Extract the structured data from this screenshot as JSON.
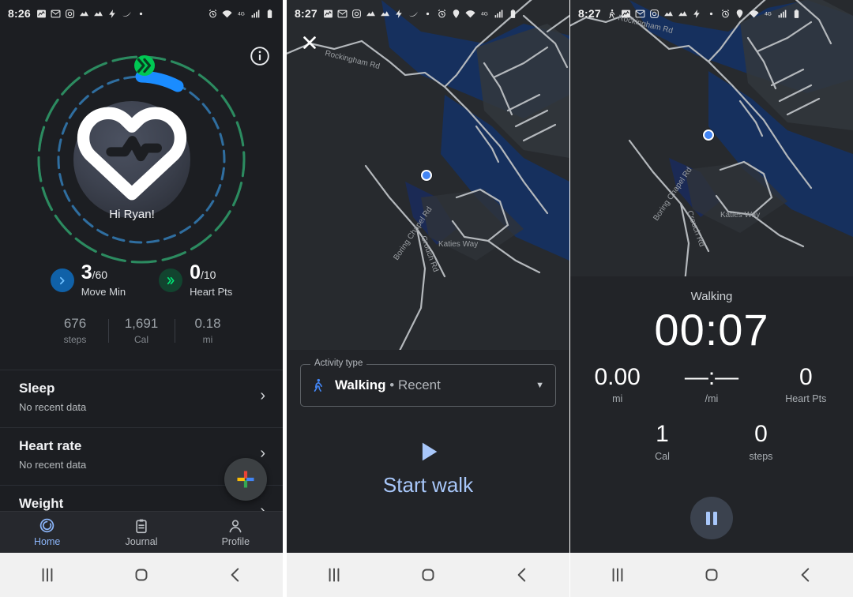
{
  "panels": {
    "home": {
      "statusbar": {
        "clock": "8:26",
        "icons": [
          "inv-icon",
          "gmail-icon",
          "instagram-icon",
          "chart-icon",
          "chart-icon",
          "bolt-icon",
          "swoosh-icon",
          "dot-icon",
          "alarm-icon",
          "wifi-icon",
          "4g-icon",
          "signal-icon",
          "battery-icon"
        ]
      },
      "info_icon": "info-icon",
      "greeting": "Hi Ryan!",
      "ring_badge_icon": "double-chevron-icon",
      "move_min": {
        "icon": "chevron-icon",
        "value": "3",
        "goal": "/60",
        "label": "Move Min"
      },
      "heart_pts": {
        "icon": "double-chevron-icon",
        "value": "0",
        "goal": "/10",
        "label": "Heart Pts"
      },
      "substats": [
        {
          "value": "676",
          "caption": "steps"
        },
        {
          "value": "1,691",
          "caption": "Cal"
        },
        {
          "value": "0.18",
          "caption": "mi"
        }
      ],
      "rows": [
        {
          "title": "Sleep",
          "subtitle": "No recent data"
        },
        {
          "title": "Heart rate",
          "subtitle": "No recent data"
        },
        {
          "title": "Weight",
          "subtitle": ""
        }
      ],
      "fab_icon": "google-plus-icon",
      "nav": [
        {
          "label": "Home",
          "icon": "home-ring-icon",
          "active": true
        },
        {
          "label": "Journal",
          "icon": "clipboard-icon",
          "active": false
        },
        {
          "label": "Profile",
          "icon": "person-icon",
          "active": false
        }
      ]
    },
    "start": {
      "statusbar": {
        "clock": "8:27",
        "icons": [
          "inv-icon",
          "gmail-icon",
          "instagram-icon",
          "chart-icon",
          "chart-icon",
          "bolt-icon",
          "swoosh-icon",
          "dot-icon",
          "alarm-icon",
          "pin-icon",
          "wifi-icon",
          "4g-icon",
          "signal-icon",
          "battery-icon"
        ]
      },
      "close_icon": "close-icon",
      "map_labels": [
        "Rockingham Rd",
        "Boring Chapel Rd",
        "Crouch Rd",
        "Katies Way"
      ],
      "activity_label": "Activity type",
      "activity_value": "Walking",
      "activity_suffix": "• Recent",
      "activity_icon": "walking-icon",
      "dropdown_icon": "chevron-down-icon",
      "start_icon": "play-icon",
      "start_label": "Start walk"
    },
    "tracking": {
      "statusbar": {
        "clock": "8:27",
        "icons": [
          "walking-icon",
          "inv-icon",
          "gmail-icon",
          "instagram-icon",
          "chart-icon",
          "chart-icon",
          "bolt-icon",
          "dot-icon",
          "alarm-icon",
          "pin-icon",
          "wifi-icon",
          "4g-icon",
          "signal-icon",
          "battery-icon"
        ]
      },
      "map_labels": [
        "Rockingham Rd",
        "Boring Chapel Rd",
        "Crouch Rd",
        "Katies Way"
      ],
      "title": "Walking",
      "timer": "00:07",
      "row1": [
        {
          "value": "0.00",
          "caption": "mi"
        },
        {
          "value": "—:—",
          "caption": "/mi"
        },
        {
          "value": "0",
          "caption": "Heart Pts"
        }
      ],
      "row2": [
        {
          "value": "1",
          "caption": "Cal"
        },
        {
          "value": "0",
          "caption": "steps"
        }
      ],
      "pause_icon": "pause-icon"
    }
  },
  "sysnav": {
    "recents_icon": "recents-icon",
    "home_icon": "home-square-icon",
    "back_icon": "back-chevron-icon"
  },
  "colors": {
    "accent_blue": "#8ab4f8",
    "move_blue": "#1a8cff",
    "heart_green": "#00c853",
    "sheet_bg": "#222428",
    "screen_bg": "#1c1e22"
  }
}
